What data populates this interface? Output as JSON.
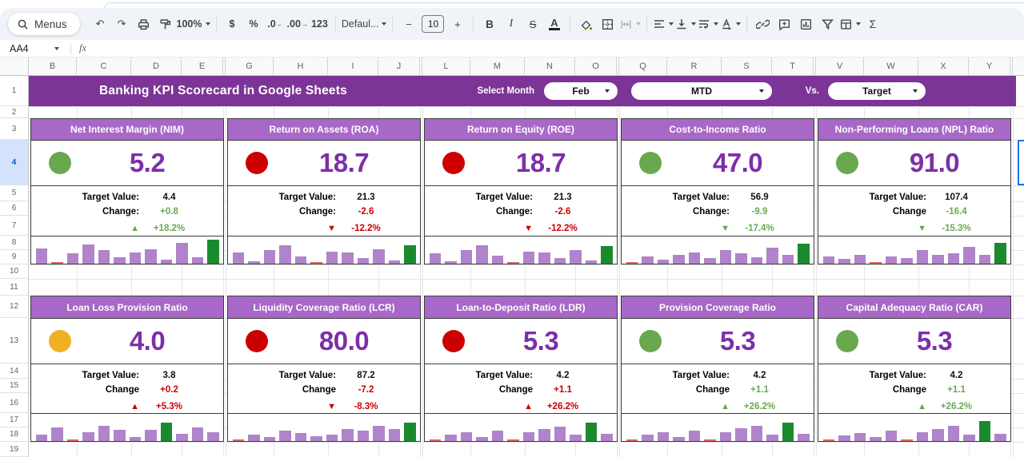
{
  "toolbar": {
    "menus": "Menus",
    "zoom": "100%",
    "currency": "$",
    "percent": "%",
    "decrease_decimal": ".0",
    "increase_decimal": ".00",
    "more_formats": "123",
    "font": "Defaul...",
    "decrease_font": "−",
    "font_size": "10",
    "increase_font": "+",
    "bold": "B",
    "italic": "I",
    "strikethrough": "S",
    "text_color": "A",
    "functions": "Σ"
  },
  "formula_bar": {
    "name_box": "AA4",
    "fx_label": "fx"
  },
  "grid": {
    "column_letters": [
      "B",
      "C",
      "D",
      "E",
      "G",
      "H",
      "I",
      "J",
      "L",
      "M",
      "N",
      "O",
      "Q",
      "R",
      "S",
      "T",
      "V",
      "W",
      "X",
      "Y"
    ],
    "row_numbers": [
      "1",
      "2",
      "3",
      "4",
      "5",
      "6",
      "7",
      "8",
      "9",
      "10",
      "11",
      "12",
      "13",
      "14",
      "15",
      "16",
      "17",
      "18",
      "19"
    ],
    "selected_cell": "AA4",
    "selected_row": "4"
  },
  "banner": {
    "title": "Banking KPI Scorecard in Google Sheets",
    "select_month_label": "Select Month",
    "month_value": "Feb",
    "period_value": "MTD",
    "vs_label": "Vs.",
    "compare_value": "Target"
  },
  "colors": {
    "banner": "#7c3596",
    "card_header": "#a868c8",
    "value_text": "#7d2fa8",
    "green": "#6aa84f",
    "red": "#cc0000",
    "yellow": "#efb022",
    "bar_purple": "#b183cb",
    "bar_green": "#1a8a2e",
    "bar_red": "#e06666"
  },
  "cards": [
    {
      "title": "Net Interest Margin (NIM)",
      "status": "green",
      "value": "5.2",
      "target_label": "Target Value:",
      "target": "4.4",
      "change_label": "Change:",
      "change": "+0.8",
      "change_color": "green",
      "arrow": "▲",
      "arrow_color": "green",
      "pct": "+18.2%",
      "pct_color": "green",
      "spark": [
        [
          62,
          "p"
        ],
        [
          6,
          "r"
        ],
        [
          42,
          "p"
        ],
        [
          80,
          "p"
        ],
        [
          58,
          "p"
        ],
        [
          28,
          "p"
        ],
        [
          48,
          "p"
        ],
        [
          60,
          "p"
        ],
        [
          15,
          "p"
        ],
        [
          85,
          "p"
        ],
        [
          25,
          "p"
        ],
        [
          100,
          "g"
        ]
      ]
    },
    {
      "title": "Return on Assets (ROA)",
      "status": "red",
      "value": "18.7",
      "target_label": "Target Value:",
      "target": "21.3",
      "change_label": "Change:",
      "change": "-2.6",
      "change_color": "red",
      "arrow": "▼",
      "arrow_color": "red",
      "pct": "-12.2%",
      "pct_color": "red",
      "spark": [
        [
          45,
          "p"
        ],
        [
          10,
          "p"
        ],
        [
          55,
          "p"
        ],
        [
          78,
          "p"
        ],
        [
          30,
          "p"
        ],
        [
          5,
          "r"
        ],
        [
          50,
          "p"
        ],
        [
          45,
          "p"
        ],
        [
          22,
          "p"
        ],
        [
          60,
          "p"
        ],
        [
          12,
          "p"
        ],
        [
          78,
          "g"
        ]
      ]
    },
    {
      "title": "Return on Equity (ROE)",
      "status": "red",
      "value": "18.7",
      "target_label": "Target Value:",
      "target": "21.3",
      "change_label": "Change:",
      "change": "-2.6",
      "change_color": "red",
      "arrow": "▼",
      "arrow_color": "red",
      "pct": "-12.2%",
      "pct_color": "red",
      "spark": [
        [
          42,
          "p"
        ],
        [
          10,
          "p"
        ],
        [
          55,
          "p"
        ],
        [
          75,
          "p"
        ],
        [
          32,
          "p"
        ],
        [
          5,
          "r"
        ],
        [
          50,
          "p"
        ],
        [
          45,
          "p"
        ],
        [
          22,
          "p"
        ],
        [
          58,
          "p"
        ],
        [
          12,
          "p"
        ],
        [
          72,
          "g"
        ]
      ]
    },
    {
      "title": "Cost-to-Income Ratio",
      "status": "green",
      "value": "47.0",
      "target_label": "Target Value:",
      "target": "56.9",
      "change_label": "Change:",
      "change": "-9.9",
      "change_color": "green",
      "arrow": "▼",
      "arrow_color": "green",
      "pct": "-17.4%",
      "pct_color": "green",
      "spark": [
        [
          5,
          "r"
        ],
        [
          30,
          "p"
        ],
        [
          18,
          "p"
        ],
        [
          38,
          "p"
        ],
        [
          48,
          "p"
        ],
        [
          22,
          "p"
        ],
        [
          55,
          "p"
        ],
        [
          42,
          "p"
        ],
        [
          25,
          "p"
        ],
        [
          65,
          "p"
        ],
        [
          35,
          "p"
        ],
        [
          82,
          "g"
        ]
      ]
    },
    {
      "title": "Non-Performing Loans (NPL) Ratio",
      "status": "green",
      "value": "91.0",
      "target_label": "Target Value:",
      "target": "107.4",
      "change_label": "Change",
      "change": "-16.4",
      "change_color": "green",
      "arrow": "▼",
      "arrow_color": "green",
      "pct": "-15.3%",
      "pct_color": "green",
      "spark": [
        [
          30,
          "p"
        ],
        [
          20,
          "p"
        ],
        [
          38,
          "p"
        ],
        [
          5,
          "r"
        ],
        [
          30,
          "p"
        ],
        [
          22,
          "p"
        ],
        [
          55,
          "p"
        ],
        [
          35,
          "p"
        ],
        [
          42,
          "p"
        ],
        [
          70,
          "p"
        ],
        [
          35,
          "p"
        ],
        [
          88,
          "g"
        ]
      ]
    },
    {
      "title": "Loan Loss Provision Ratio",
      "status": "yellow",
      "value": "4.0",
      "target_label": "Target Value:",
      "target": "3.8",
      "change_label": "Change",
      "change": "+0.2",
      "change_color": "red",
      "arrow": "▲",
      "arrow_color": "red",
      "pct": "+5.3%",
      "pct_color": "red",
      "spark": [
        [
          25,
          "p"
        ],
        [
          55,
          "p"
        ],
        [
          5,
          "r"
        ],
        [
          35,
          "p"
        ],
        [
          62,
          "p"
        ],
        [
          45,
          "p"
        ],
        [
          15,
          "p"
        ],
        [
          45,
          "p"
        ],
        [
          78,
          "g"
        ],
        [
          30,
          "p"
        ],
        [
          55,
          "p"
        ],
        [
          38,
          "p"
        ]
      ]
    },
    {
      "title": "Liquidity Coverage Ratio (LCR)",
      "status": "red",
      "value": "80.0",
      "target_label": "Target Value:",
      "target": "87.2",
      "change_label": "Change",
      "change": "-7.2",
      "change_color": "red",
      "arrow": "▼",
      "arrow_color": "red",
      "pct": "-8.3%",
      "pct_color": "red",
      "spark": [
        [
          5,
          "r"
        ],
        [
          25,
          "p"
        ],
        [
          18,
          "p"
        ],
        [
          42,
          "p"
        ],
        [
          32,
          "p"
        ],
        [
          20,
          "p"
        ],
        [
          28,
          "p"
        ],
        [
          50,
          "p"
        ],
        [
          42,
          "p"
        ],
        [
          62,
          "p"
        ],
        [
          50,
          "p"
        ],
        [
          78,
          "g"
        ]
      ]
    },
    {
      "title": "Loan-to-Deposit Ratio (LDR)",
      "status": "red",
      "value": "5.3",
      "target_label": "Target Value:",
      "target": "4.2",
      "change_label": "Change",
      "change": "+1.1",
      "change_color": "red",
      "arrow": "▲",
      "arrow_color": "red",
      "pct": "+26.2%",
      "pct_color": "red",
      "spark": [
        [
          5,
          "r"
        ],
        [
          25,
          "p"
        ],
        [
          35,
          "p"
        ],
        [
          15,
          "p"
        ],
        [
          42,
          "p"
        ],
        [
          5,
          "r"
        ],
        [
          35,
          "p"
        ],
        [
          50,
          "p"
        ],
        [
          60,
          "p"
        ],
        [
          25,
          "p"
        ],
        [
          78,
          "g"
        ],
        [
          30,
          "p"
        ]
      ]
    },
    {
      "title": "Provision Coverage Ratio",
      "status": "green",
      "value": "5.3",
      "target_label": "Target Value:",
      "target": "4.2",
      "change_label": "Change",
      "change": "+1.1",
      "change_color": "green",
      "arrow": "▲",
      "arrow_color": "green",
      "pct": "+26.2%",
      "pct_color": "green",
      "spark": [
        [
          5,
          "r"
        ],
        [
          25,
          "p"
        ],
        [
          35,
          "p"
        ],
        [
          15,
          "p"
        ],
        [
          42,
          "p"
        ],
        [
          5,
          "r"
        ],
        [
          35,
          "p"
        ],
        [
          52,
          "p"
        ],
        [
          62,
          "p"
        ],
        [
          25,
          "p"
        ],
        [
          78,
          "g"
        ],
        [
          30,
          "p"
        ]
      ]
    },
    {
      "title": "Capital Adequacy Ratio (CAR)",
      "status": "green",
      "value": "5.3",
      "target_label": "Target Value:",
      "target": "4.2",
      "change_label": "Change",
      "change": "+1.1",
      "change_color": "green",
      "arrow": "▲",
      "arrow_color": "green",
      "pct": "+26.2%",
      "pct_color": "green",
      "spark": [
        [
          5,
          "r"
        ],
        [
          22,
          "p"
        ],
        [
          32,
          "p"
        ],
        [
          15,
          "p"
        ],
        [
          42,
          "p"
        ],
        [
          5,
          "r"
        ],
        [
          35,
          "p"
        ],
        [
          50,
          "p"
        ],
        [
          62,
          "p"
        ],
        [
          25,
          "p"
        ],
        [
          82,
          "g"
        ],
        [
          30,
          "p"
        ]
      ]
    }
  ]
}
